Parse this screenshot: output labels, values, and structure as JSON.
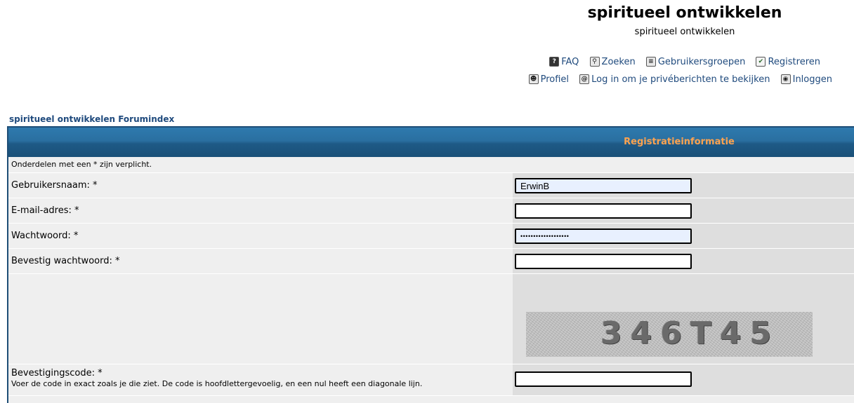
{
  "site": {
    "title": "spiritueel ontwikkelen",
    "description": "spiritueel ontwikkelen"
  },
  "nav": {
    "row1": [
      {
        "label": "FAQ",
        "icon": "faq-icon"
      },
      {
        "label": "Zoeken",
        "icon": "search-icon"
      },
      {
        "label": "Gebruikersgroepen",
        "icon": "usergroups-icon"
      },
      {
        "label": "Registreren",
        "icon": "register-icon"
      }
    ],
    "row2": [
      {
        "label": "Profiel",
        "icon": "profile-icon"
      },
      {
        "label": "Log in om je privéberichten te bekijken",
        "icon": "messages-icon"
      },
      {
        "label": "Inloggen",
        "icon": "login-icon"
      }
    ]
  },
  "breadcrumb": "spiritueel ontwikkelen Forumindex",
  "form": {
    "header": "Registratieinformatie",
    "required_note": "Onderdelen met een * zijn verplicht.",
    "fields": {
      "username": {
        "label": "Gebruikersnaam: *",
        "value": "ErwinB"
      },
      "email": {
        "label": "E-mail-adres: *",
        "value": ""
      },
      "password": {
        "label": "Wachtwoord: *",
        "value": "•••••••••••••••••••"
      },
      "confirm_password": {
        "label": "Bevestig wachtwoord: *",
        "value": ""
      }
    },
    "captcha": {
      "text": "346T45"
    },
    "code": {
      "label": "Bevestigingscode: *",
      "hint": "Voer de code in exact zoals je die ziet. De code is hoofdlettergevoelig, en een nul heeft een diagonale lijn.",
      "value": ""
    }
  },
  "colors": {
    "link": "#1f4a7d",
    "header_bar": "#2a6fa0",
    "header_text": "#ffa34f",
    "row_light": "#efefef",
    "row_dark": "#dedede"
  }
}
